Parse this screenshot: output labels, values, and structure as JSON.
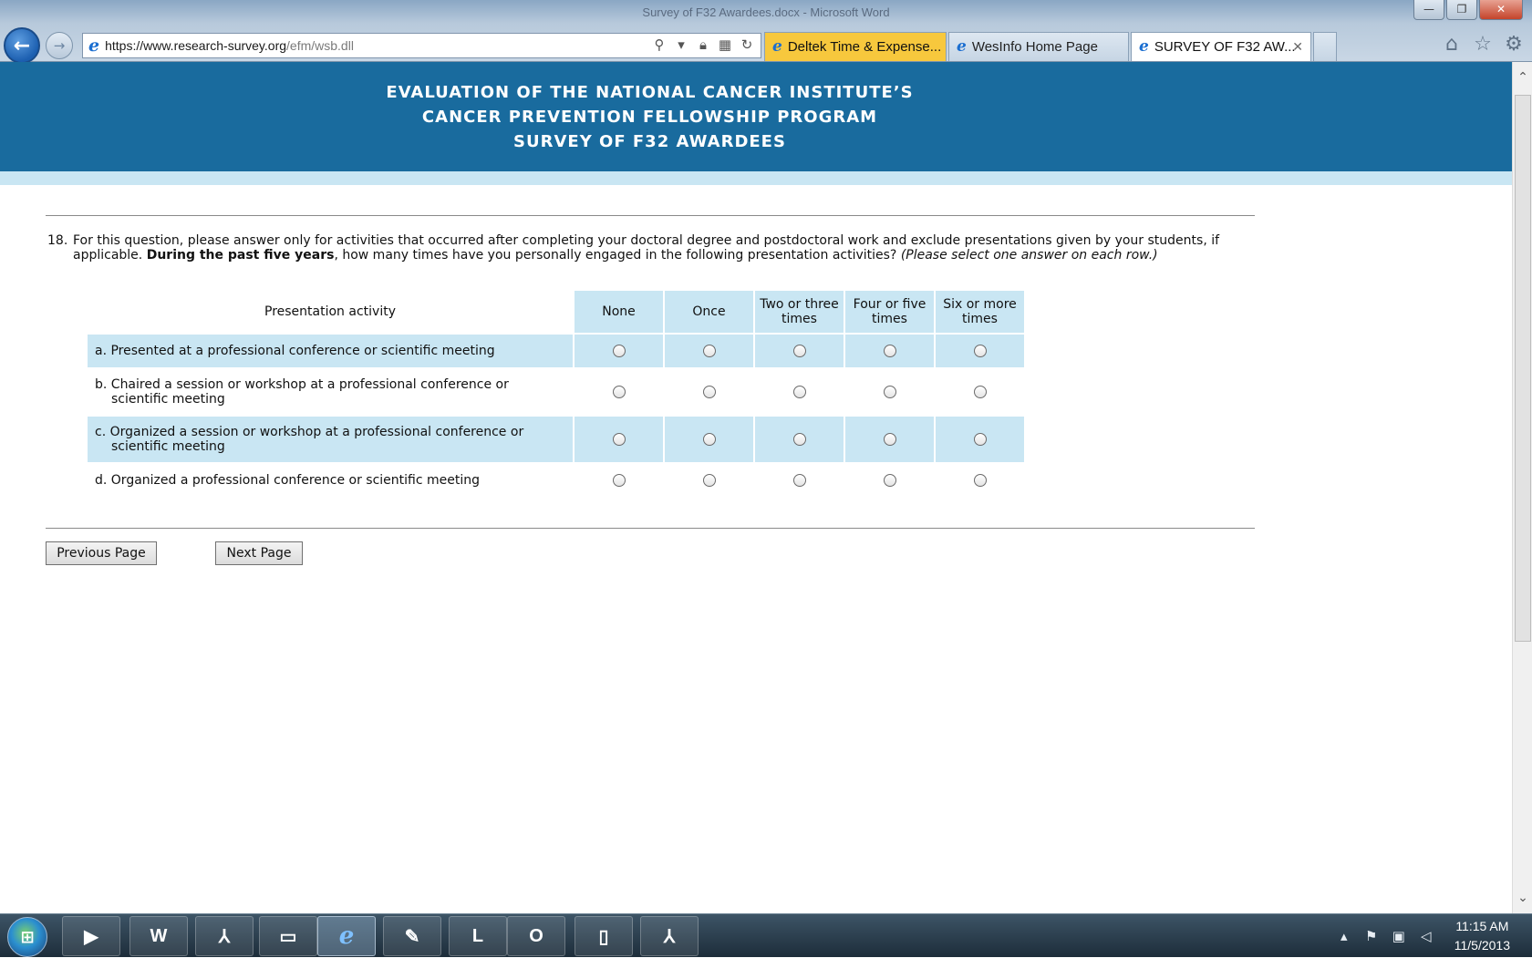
{
  "window": {
    "title": "Survey of F32 Awardees.docx - Microsoft Word",
    "minimize_glyph": "—",
    "restore_glyph": "❐",
    "close_glyph": "✕"
  },
  "browser": {
    "address": {
      "host": "https://www.research-survey.org",
      "path": "/efm/wsb.dll"
    },
    "tabs": [
      {
        "label": "Deltek Time & Expense..."
      },
      {
        "label": "WesInfo Home Page"
      },
      {
        "label": "SURVEY OF F32 AW..."
      }
    ],
    "icons": {
      "back": "back-arrow-icon",
      "forward": "forward-arrow-icon",
      "search": "search-icon",
      "lock": "lock-icon",
      "compat": "compatibility-view-icon",
      "refresh": "refresh-icon",
      "home": "home-icon",
      "favorites": "star-icon",
      "settings": "gear-icon"
    }
  },
  "banner": {
    "line1": "EVALUATION OF THE NATIONAL CANCER INSTITUTE’S",
    "line2": "CANCER PREVENTION FELLOWSHIP PROGRAM",
    "line3": "SURVEY OF F32 AWARDEES",
    "color": "#196b9e",
    "accent": "#c9e6f3"
  },
  "question": {
    "number": "18.",
    "text_1": "For this question, please answer only for activities that occurred after completing your doctoral degree and postdoctoral work and exclude presentations given by your students, if applicable. ",
    "text_bold": "During the past five years",
    "text_2": ", how many times have you personally engaged in the following presentation activities? ",
    "text_italic": "(Please select one answer on each row.)"
  },
  "grid": {
    "header_activity": "Presentation activity",
    "options": [
      "None",
      "Once",
      "Two or three times",
      "Four or five times",
      "Six or more times"
    ],
    "rows": [
      {
        "label": "a. Presented at a professional conference or scientific meeting"
      },
      {
        "label": "b. Chaired a session or workshop at a professional conference or scientific meeting"
      },
      {
        "label": "c. Organized a session or workshop at a professional conference or scientific meeting"
      },
      {
        "label": "d. Organized a professional conference or scientific meeting"
      }
    ]
  },
  "nav": {
    "previous": "Previous Page",
    "next": "Next Page"
  },
  "taskbar": {
    "apps": [
      "media-player-icon",
      "word-icon",
      "acrobat-icon",
      "folder-icon",
      "internet-explorer-icon",
      "notes-icon",
      "lync-icon",
      "outlook-icon",
      "blank-document-icon",
      "pdf-icon"
    ],
    "app_letters": {
      "word": "W",
      "outlook": "O"
    },
    "time": "11:15 AM",
    "date": "11/5/2013"
  }
}
